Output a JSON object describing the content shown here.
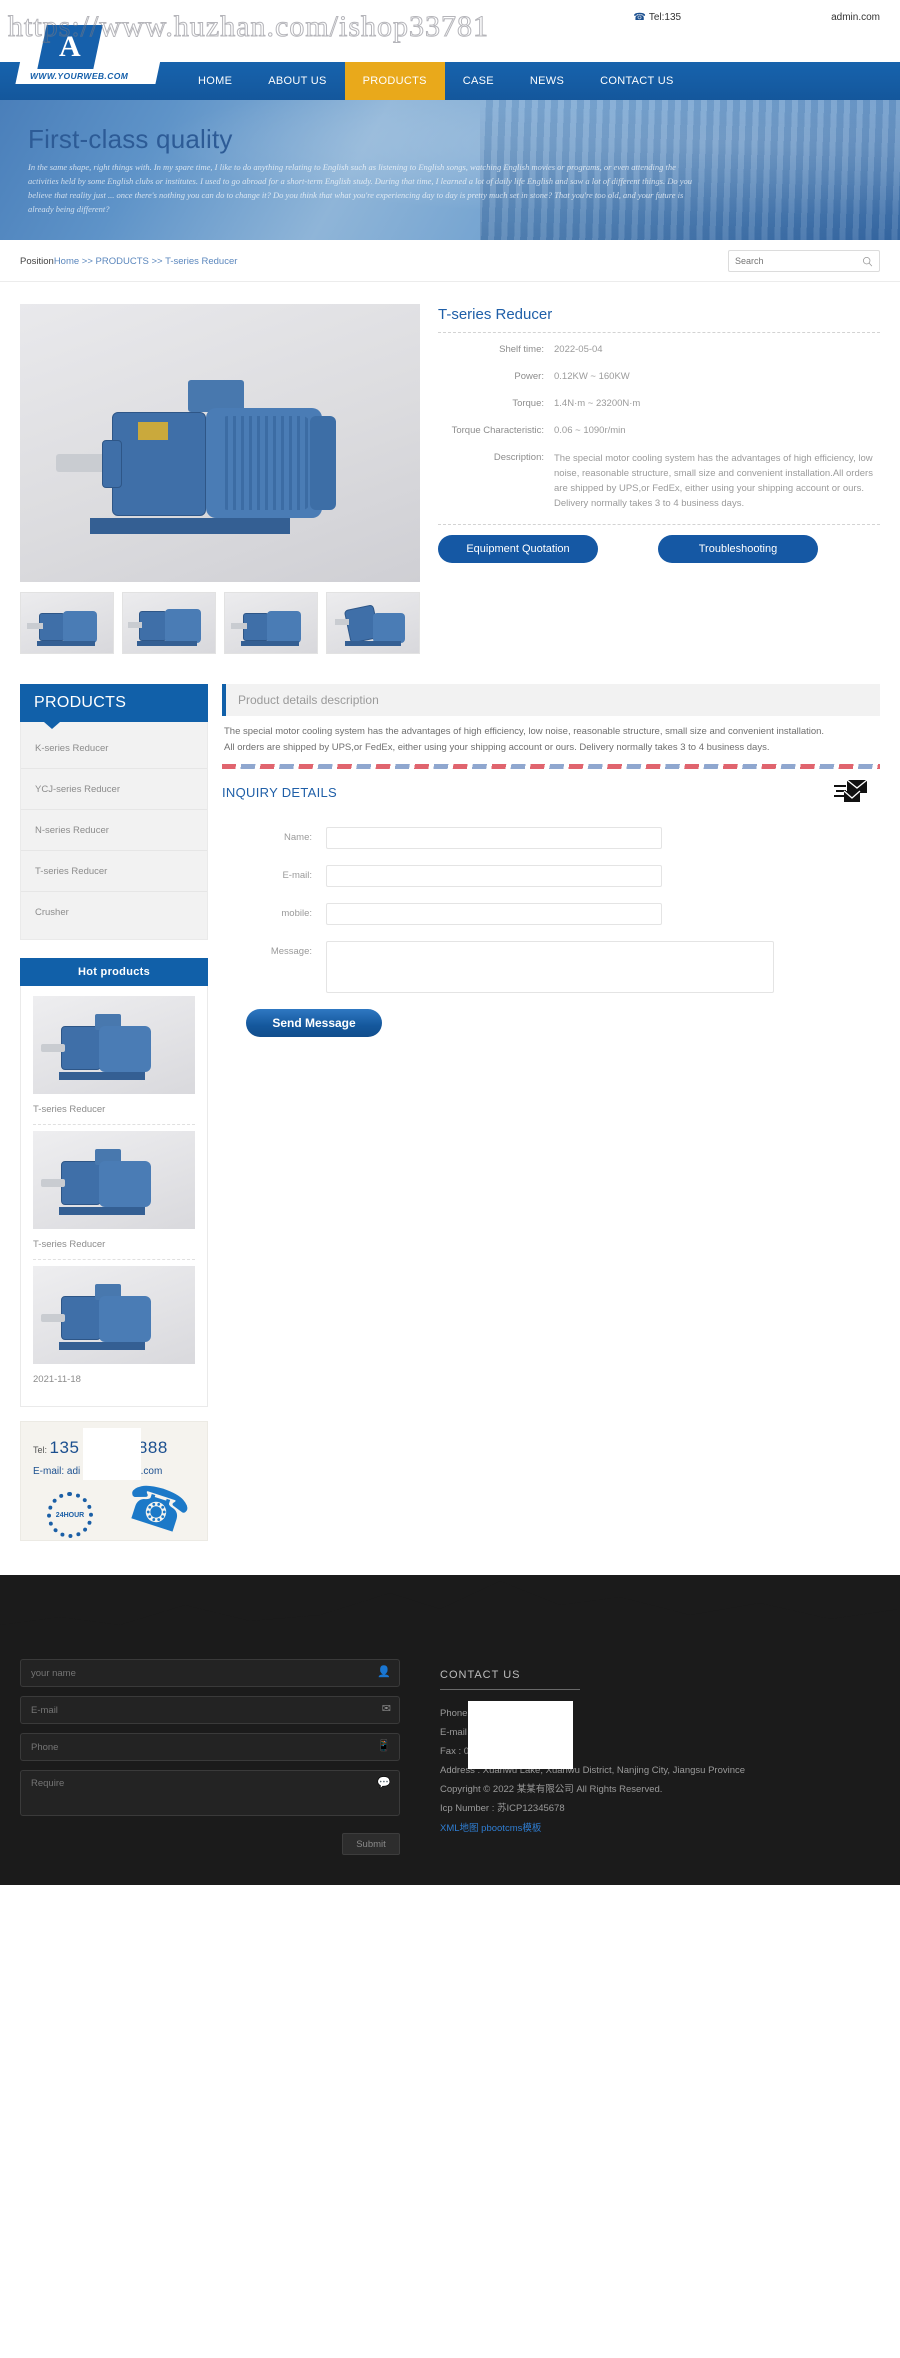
{
  "watermark": "https://www.huzhan.com/ishop33781",
  "topbar": {
    "phone_icon": "phone-icon",
    "tel": "Tel:135",
    "admin": "admin.com"
  },
  "logo": {
    "letter": "A",
    "url": "WWW.YOURWEB.COM"
  },
  "nav": {
    "items": [
      {
        "label": "HOME",
        "active": false
      },
      {
        "label": "ABOUT US",
        "active": false
      },
      {
        "label": "PRODUCTS",
        "active": true
      },
      {
        "label": "CASE",
        "active": false
      },
      {
        "label": "NEWS",
        "active": false
      },
      {
        "label": "CONTACT US",
        "active": false
      }
    ]
  },
  "banner": {
    "title": "First-class quality",
    "script": "In the same shape, right things with. In my spare time, I like to do anything relating to English such as listening to English songs, watching English movies or programs, or even attending the activities held by some English clubs or institutes. I used to go abroad for a short-term English study. During that time, I learned a lot of daily life English and saw a lot of different things. Do you believe that reality just ... once there's nothing you can do to change it? Do you think that what you're experiencing day to day is pretty much set in stone? That you're too old, and your future is already being different?"
  },
  "breadcrumb": {
    "label": "Position",
    "home": "Home",
    "sep": ">>",
    "category": "PRODUCTS",
    "current": "T-series Reducer"
  },
  "search": {
    "placeholder": "Search",
    "icon": "search-icon"
  },
  "product": {
    "title": "T-series Reducer",
    "specs": [
      {
        "key": "Shelf time:",
        "value": "2022-05-04"
      },
      {
        "key": "Power:",
        "value": "0.12KW ~ 160KW"
      },
      {
        "key": "Torque:",
        "value": "1.4N·m ~ 23200N·m"
      },
      {
        "key": "Torque Characteristic:",
        "value": "0.06 ~ 1090r/min"
      },
      {
        "key": "Description:",
        "value": "The special motor cooling system has the advantages of high efficiency, low noise, reasonable structure, small size and convenient installation.All orders are shipped by UPS,or FedEx, either using your shipping account or ours. Delivery normally takes 3 to 4 business days."
      }
    ],
    "buttons": {
      "quotation": "Equipment Quotation",
      "troubleshooting": "Troubleshooting"
    },
    "thumbs": [
      "thumb-1",
      "thumb-2",
      "thumb-3",
      "thumb-4"
    ]
  },
  "sidebar": {
    "products_title": "PRODUCTS",
    "categories": [
      {
        "label": "K-series Reducer"
      },
      {
        "label": "YCJ-series Reducer"
      },
      {
        "label": "N-series Reducer"
      },
      {
        "label": "T-series Reducer"
      },
      {
        "label": "Crusher"
      }
    ],
    "hot_title": "Hot products",
    "hot_items": [
      {
        "caption": "T-series Reducer"
      },
      {
        "caption": "T-series Reducer"
      },
      {
        "caption": "2021-11-18"
      }
    ],
    "contact_card": {
      "tel_label": "Tel:",
      "tel_number_start": "135",
      "tel_number_end": "888",
      "mail_label": "E-mail:",
      "mail_start": "adi",
      "mail_end": "n.com",
      "badge": "24HOUR"
    }
  },
  "details_section": {
    "heading": "Product details description",
    "body_line1": "The special motor cooling system has the advantages of high efficiency, low noise, reasonable structure, small size and convenient installation.",
    "body_line2": "All orders are shipped by UPS,or FedEx, either using your shipping account or ours. Delivery normally takes 3 to 4 business days."
  },
  "inquiry": {
    "title": "INQUIRY DETAILS",
    "mail_icon": "mail-icon",
    "fields": [
      {
        "label": "Name:",
        "value": "",
        "placeholder": ""
      },
      {
        "label": "E-mail:",
        "value": "",
        "placeholder": ""
      },
      {
        "label": "mobile:",
        "value": "",
        "placeholder": ""
      },
      {
        "label": "Message:",
        "value": "",
        "placeholder": ""
      }
    ],
    "submit": "Send  Message"
  },
  "footer": {
    "form": {
      "name_placeholder": "your name",
      "email_placeholder": "E-mail",
      "phone_placeholder": "Phone",
      "require_placeholder": "Require",
      "submit": "Submit",
      "name_icon": "user-icon",
      "email_icon": "envelope-icon",
      "phone_icon": "mobile-icon",
      "require_icon": "comment-icon"
    },
    "contact": {
      "title": "CONTACT US",
      "phone": "Phone :40                    88888",
      "email": "E-mail : a",
      "fax": "Fax : 010",
      "address": "Address : Xuanwu Lake, Xuanwu District, Nanjing City, Jiangsu Province",
      "copyright": "Copyright © 2022 某某有限公司 All Rights Reserved.",
      "icp": "Icp Number : 苏ICP12345678",
      "links": "XML地图 pbootcms模板"
    }
  },
  "colors": {
    "nav_blue": "#15599e",
    "accent_orange": "#e9a91b",
    "link_blue": "#1f5fa8",
    "footer_bg": "#1b1b1b"
  }
}
